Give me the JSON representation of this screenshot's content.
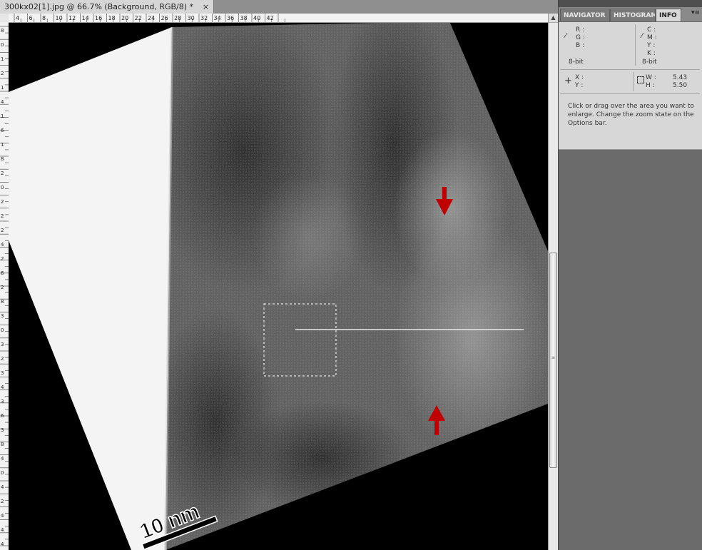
{
  "document": {
    "tab_title": "300kx02[1].jpg @ 66.7% (Background, RGB/8) *",
    "close_glyph": "×"
  },
  "ruler": {
    "horizontal_labels": [
      "4",
      "6",
      "8",
      "10",
      "12",
      "14",
      "16",
      "18",
      "20",
      "22",
      "24",
      "26",
      "28",
      "30",
      "32",
      "34",
      "36",
      "38",
      "40",
      "42"
    ],
    "vertical_labels": [
      "8",
      "0",
      "1",
      "2",
      "1",
      "4",
      "1",
      "6",
      "1",
      "8",
      "2",
      "0",
      "2",
      "2",
      "2",
      "4",
      "2",
      "6",
      "2",
      "8",
      "3",
      "0",
      "3",
      "2",
      "3",
      "4",
      "3",
      "6",
      "3",
      "8",
      "4",
      "0",
      "4",
      "2",
      "4",
      "4",
      "4",
      "6"
    ]
  },
  "image": {
    "scale_bar_label": "10 nm",
    "arrow_color": "#c00000",
    "selection": "marquee"
  },
  "panel": {
    "tabs": [
      {
        "label": "NAVIGATOR",
        "active": false
      },
      {
        "label": "HISTOGRAM",
        "active": false
      },
      {
        "label": "INFO",
        "active": true
      }
    ],
    "menu_glyph": "▾≡",
    "info": {
      "r_label": "R :",
      "g_label": "G :",
      "b_label": "B :",
      "c_label": "C :",
      "m_label": "M :",
      "y_label": "Y :",
      "k_label": "K :",
      "bit_left": "8-bit",
      "bit_right": "8-bit",
      "x_label": "X :",
      "y_pos_label": "Y :",
      "w_label": "W :",
      "h_label": "H :",
      "w_value": "5.43",
      "h_value": "5.50",
      "hint": "Click or drag over the area you want to enlarge. Change the zoom state on the Options bar."
    }
  }
}
